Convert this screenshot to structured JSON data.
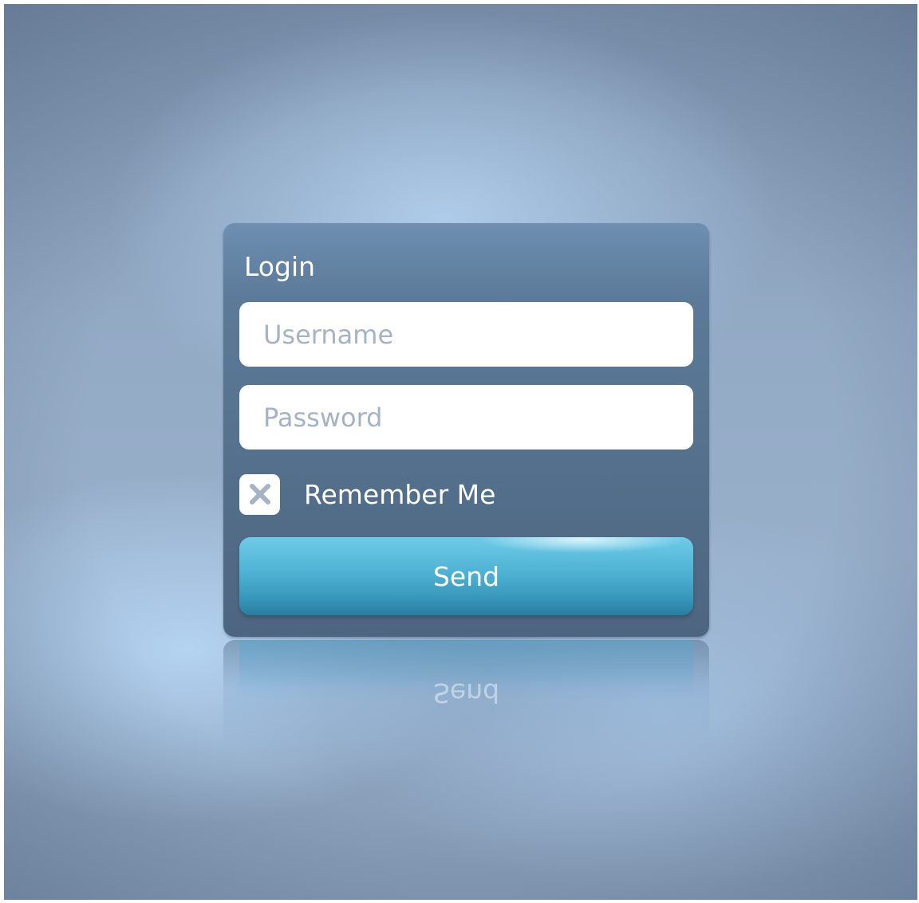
{
  "login_form": {
    "title": "Login",
    "username": {
      "value": "",
      "placeholder": "Username"
    },
    "password": {
      "value": "",
      "placeholder": "Password"
    },
    "remember": {
      "label": "Remember Me",
      "checked": true,
      "check_icon": "x-mark-icon"
    },
    "send_label": "Send"
  },
  "colors": {
    "card": "#55718d",
    "button": "#4fb2d4",
    "placeholder": "#a4b3c6",
    "check_mark": "#a4b3c6",
    "text": "#ffffff"
  }
}
